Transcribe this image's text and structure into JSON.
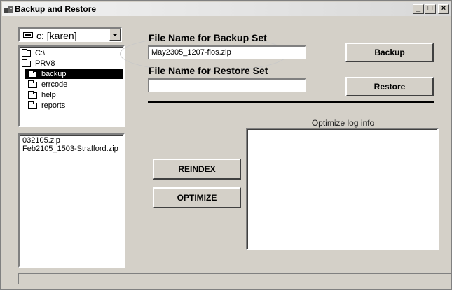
{
  "window": {
    "title": "Backup and Restore",
    "min_label": "_",
    "max_label": "□",
    "close_label": "×"
  },
  "drive": {
    "selected": "c: [karen]"
  },
  "directories": [
    {
      "label": "C:\\",
      "state": "open"
    },
    {
      "label": "PRV8",
      "state": "open"
    },
    {
      "label": "backup",
      "state": "selected"
    },
    {
      "label": "errcode",
      "state": "closed"
    },
    {
      "label": "help",
      "state": "closed"
    },
    {
      "label": "reports",
      "state": "closed"
    }
  ],
  "files": [
    "032105.zip",
    "Feb2105_1503-Strafford.zip"
  ],
  "backup": {
    "heading": "File Name for Backup Set",
    "value": "May2305_1207-flos.zip",
    "button": "Backup"
  },
  "restore": {
    "heading": "File Name for Restore Set",
    "value": "",
    "button": "Restore"
  },
  "actions": {
    "reindex": "REINDEX",
    "optimize": "OPTIMIZE"
  },
  "log": {
    "title": "Optimize log info",
    "content": ""
  },
  "status": {
    "text": ""
  }
}
